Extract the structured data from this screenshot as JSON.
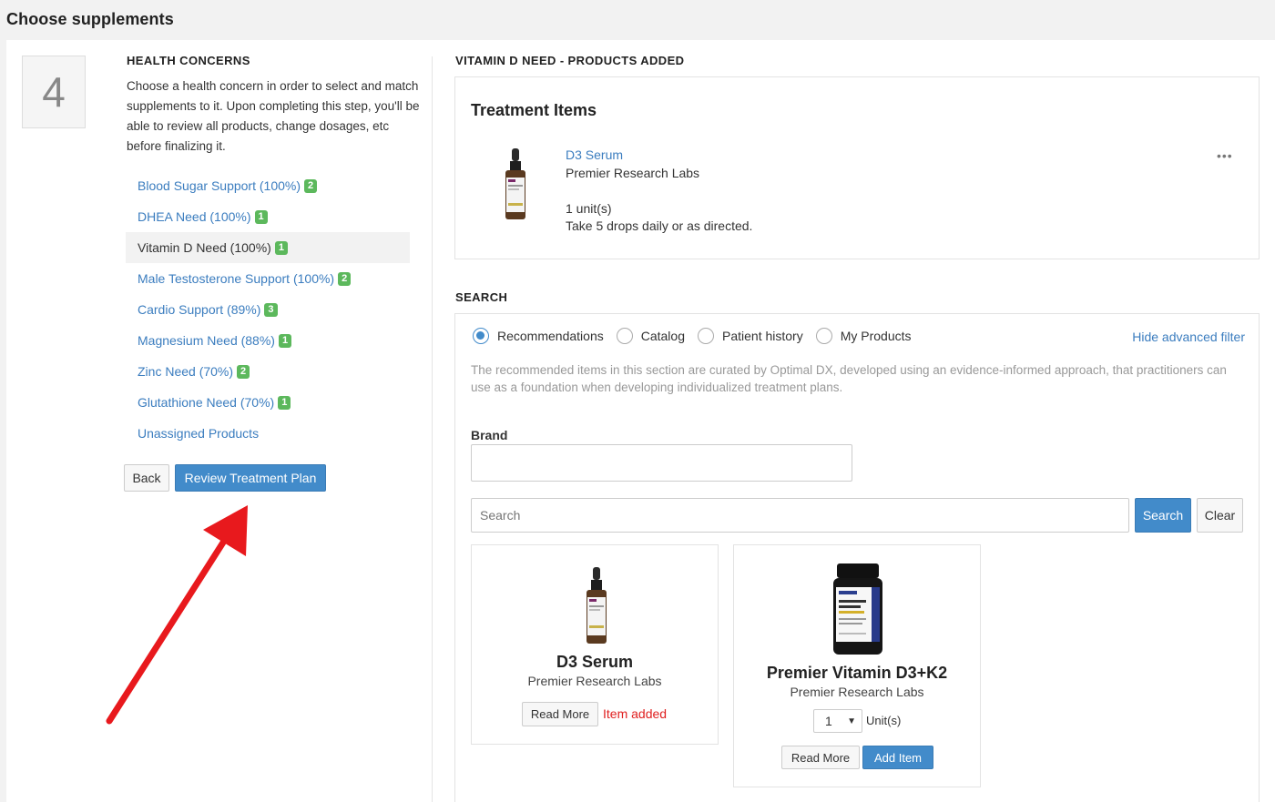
{
  "page": {
    "title": "Choose supplements"
  },
  "step": {
    "number": "4"
  },
  "health_concerns": {
    "heading": "HEALTH CONCERNS",
    "description": "Choose a health concern in order to select and match supplements to it. Upon completing this step, you'll be able to review all products, change dosages, etc before finalizing it.",
    "items": [
      {
        "label": "Blood Sugar Support (100%)",
        "count": "2"
      },
      {
        "label": "DHEA Need (100%)",
        "count": "1"
      },
      {
        "label": "Vitamin D Need (100%)",
        "count": "1"
      },
      {
        "label": "Male Testosterone Support (100%)",
        "count": "2"
      },
      {
        "label": "Cardio Support (89%)",
        "count": "3"
      },
      {
        "label": "Magnesium Need (88%)",
        "count": "1"
      },
      {
        "label": "Zinc Need (70%)",
        "count": "2"
      },
      {
        "label": "Glutathione Need (70%)",
        "count": "1"
      },
      {
        "label": "Unassigned Products",
        "count": ""
      }
    ],
    "back_label": "Back",
    "review_label": "Review Treatment Plan"
  },
  "treatment": {
    "heading": "VITAMIN D NEED - PRODUCTS ADDED",
    "card_title": "Treatment Items",
    "item": {
      "name": "D3 Serum",
      "brand": "Premier Research Labs",
      "quantity": "1 unit(s)",
      "dosage": "Take 5 drops daily or as directed.",
      "menu_icon": "more-horizontal-icon"
    }
  },
  "search": {
    "heading": "SEARCH",
    "tabs": [
      {
        "label": "Recommendations",
        "selected": true
      },
      {
        "label": "Catalog",
        "selected": false
      },
      {
        "label": "Patient history",
        "selected": false
      },
      {
        "label": "My Products",
        "selected": false
      }
    ],
    "hide_filter_label": "Hide advanced filter",
    "note": "The recommended items in this section are curated by Optimal DX, developed using an evidence-informed approach, that practitioners can use as a foundation when developing individualized treatment plans.",
    "brand_label": "Brand",
    "brand_value": "",
    "search_placeholder": "Search",
    "search_button": "Search",
    "clear_button": "Clear"
  },
  "products": [
    {
      "name": "D3 Serum",
      "brand": "Premier Research Labs",
      "read_more": "Read More",
      "status": "Item added"
    },
    {
      "name": "Premier Vitamin D3+K2",
      "brand": "Premier Research Labs",
      "read_more": "Read More",
      "quantity": "1",
      "unit_label": "Unit(s)",
      "add_label": "Add Item"
    }
  ],
  "colors": {
    "link": "#3b7dbf",
    "primary": "#428bca",
    "badge": "#5cb85c",
    "added": "#e02020",
    "arrow": "#e8191d"
  }
}
